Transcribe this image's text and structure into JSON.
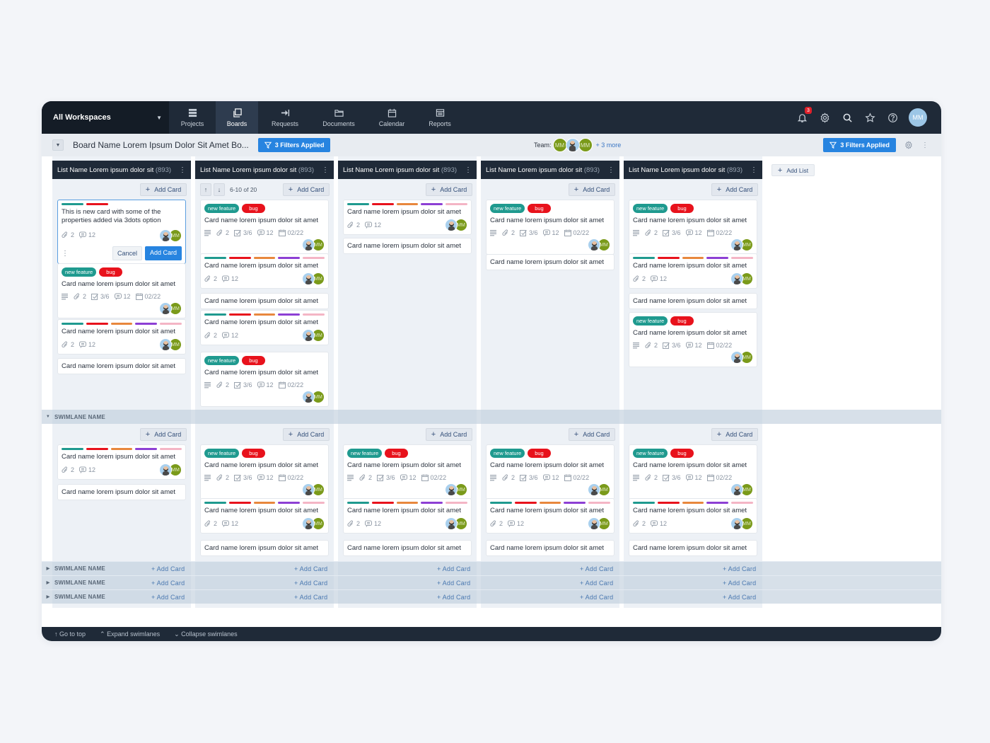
{
  "topnav": {
    "workspace": "All Workspaces",
    "items": [
      {
        "label": "Projects",
        "icon": "projects-icon"
      },
      {
        "label": "Boards",
        "icon": "boards-icon",
        "active": true
      },
      {
        "label": "Requests",
        "icon": "requests-icon"
      },
      {
        "label": "Documents",
        "icon": "documents-icon"
      },
      {
        "label": "Calendar",
        "icon": "calendar-icon"
      },
      {
        "label": "Reports",
        "icon": "reports-icon"
      }
    ],
    "notification_count": "3",
    "user_initials": "MM"
  },
  "subbar": {
    "board_name": "Board Name Lorem Ipsum Dolor Sit Amet Bo...",
    "filter_label": "3 Filters Applied",
    "team_label": "Team:",
    "team_members": [
      "MM",
      "photo",
      "MM"
    ],
    "team_more": "+ 3 more",
    "filter_label_right": "3 Filters Applied"
  },
  "labels": {
    "add_card": "Add Card",
    "add_list": "Add List",
    "cancel": "Cancel",
    "card_name": "Card name lorem ipsum dolor sit amet",
    "tag_feature": "new feature",
    "tag_bug": "bug",
    "attachments": "2",
    "checklist": "3/6",
    "comments": "12",
    "due": "02/22",
    "avatar_initials": "MM"
  },
  "colors": {
    "teal": "#1f9a8f",
    "red": "#e8121c",
    "orange": "#e8873d",
    "purple": "#8d3fd4",
    "pink": "#f4b5c5",
    "primary": "#2784e0",
    "nav": "#1f2a38"
  },
  "lists": [
    {
      "name": "List Name Lorem ipsum dolor sit",
      "count": "(893)"
    },
    {
      "name": "List Name Lorem ipsum dolor sit",
      "count": "(893)",
      "pager": "6-10 of 20"
    },
    {
      "name": "List Name Lorem ipsum dolor sit",
      "count": "(893)"
    },
    {
      "name": "List Name Lorem ipsum dolor sit",
      "count": "(893)"
    },
    {
      "name": "List Name Lorem ipsum dolor sit",
      "count": "(893)"
    }
  ],
  "new_card": {
    "title": "This is new card with some of the properties added via 3dots option",
    "attachments": "2",
    "comments": "12"
  },
  "swimlanes": [
    {
      "name": "SWIMLANE NAME",
      "expanded": true
    },
    {
      "name": "SWIMLANE NAME",
      "expanded": false
    },
    {
      "name": "SWIMLANE NAME",
      "expanded": false
    },
    {
      "name": "SWIMLANE NAME",
      "expanded": false
    }
  ],
  "swim_add_card": "+ Add Card",
  "footer": {
    "go_top": "↑ Go to top",
    "expand": "⌃ Expand swimlanes",
    "collapse": "⌄ Collapse swimlanes"
  }
}
